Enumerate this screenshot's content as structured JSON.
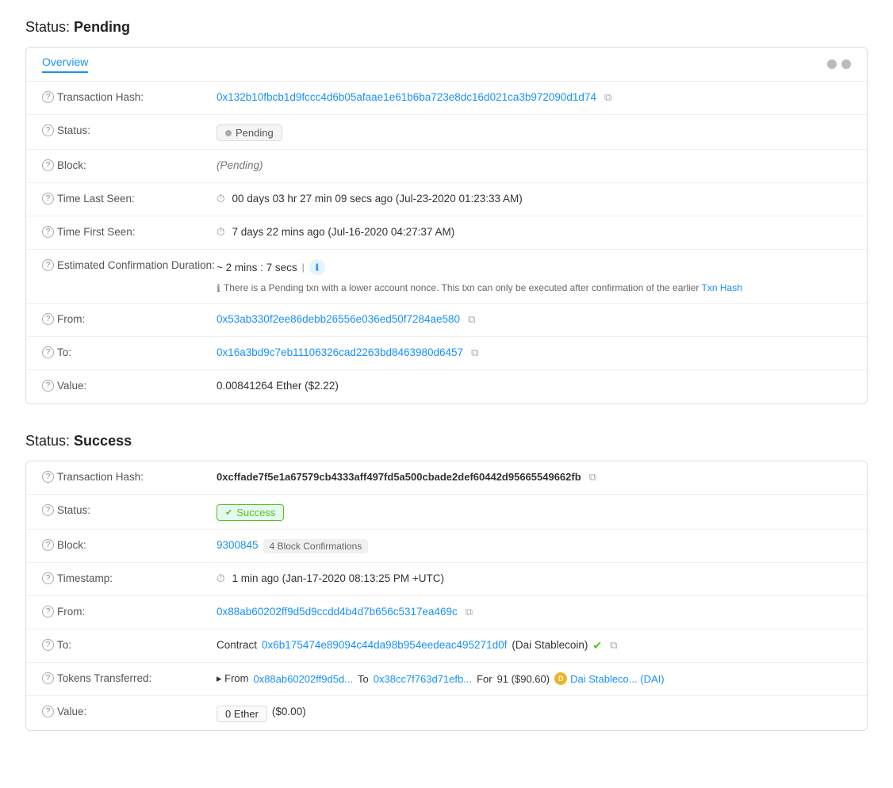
{
  "pending": {
    "section_title": "Status:",
    "section_status": "Pending",
    "tab_label": "Overview",
    "rows": {
      "tx_hash_label": "Transaction Hash:",
      "tx_hash_value": "0x132b10fbcb1d9fccc4d6b05afaae1e61b6ba723e8dc16d021ca3b972090d1d74",
      "status_label": "Status:",
      "status_value": "Pending",
      "block_label": "Block:",
      "block_value": "(Pending)",
      "time_last_seen_label": "Time Last Seen:",
      "time_last_seen_value": "00 days 03 hr 27 min 09 secs ago (Jul-23-2020 01:23:33 AM)",
      "time_first_seen_label": "Time First Seen:",
      "time_first_seen_value": "7 days 22 mins ago (Jul-16-2020 04:27:37 AM)",
      "est_confirm_label": "Estimated Confirmation Duration:",
      "est_confirm_value": "~ 2 mins : 7 secs",
      "pending_note": "There is a Pending txn with a lower account nonce. This txn can only be executed after confirmation of the earlier Txn Hash",
      "from_label": "From:",
      "from_value": "0x53ab330f2ee86debb26556e036ed50f7284ae580",
      "to_label": "To:",
      "to_value": "0x16a3bd9c7eb11106326cad2263bd8463980d6457",
      "value_label": "Value:",
      "value_amount": "0.00841264 Ether ($2.22)"
    }
  },
  "success": {
    "section_title": "Status:",
    "section_status": "Success",
    "rows": {
      "tx_hash_label": "Transaction Hash:",
      "tx_hash_value": "0xcffade7f5e1a67579cb4333aff497fd5a500cbade2def60442d95665549662fb",
      "status_label": "Status:",
      "status_value": "Success",
      "block_label": "Block:",
      "block_number": "9300845",
      "block_confirmations": "4 Block Confirmations",
      "timestamp_label": "Timestamp:",
      "timestamp_value": "1 min ago (Jan-17-2020 08:13:25 PM +UTC)",
      "from_label": "From:",
      "from_value": "0x88ab60202ff9d5d9ccdd4b4d7b656c5317ea469c",
      "to_label": "To:",
      "to_prefix": "Contract",
      "to_contract": "0x6b175474e89094c44da98b954eedeac495271d0f",
      "to_name": "(Dai Stablecoin)",
      "tokens_label": "Tokens Transferred:",
      "tokens_from_prefix": "▸ From",
      "tokens_from": "0x88ab60202ff9d5d...",
      "tokens_to_prefix": "To",
      "tokens_to": "0x38cc7f763d71efb...",
      "tokens_for": "For",
      "tokens_amount": "91 ($90.60)",
      "tokens_name": "Dai Stableco... (DAI)",
      "value_label": "Value:",
      "value_amount": "0 Ether",
      "value_usd": "($0.00)"
    }
  },
  "icons": {
    "help": "?",
    "copy": "⧉",
    "clock": "⏱",
    "check": "✔",
    "info": "ℹ"
  }
}
